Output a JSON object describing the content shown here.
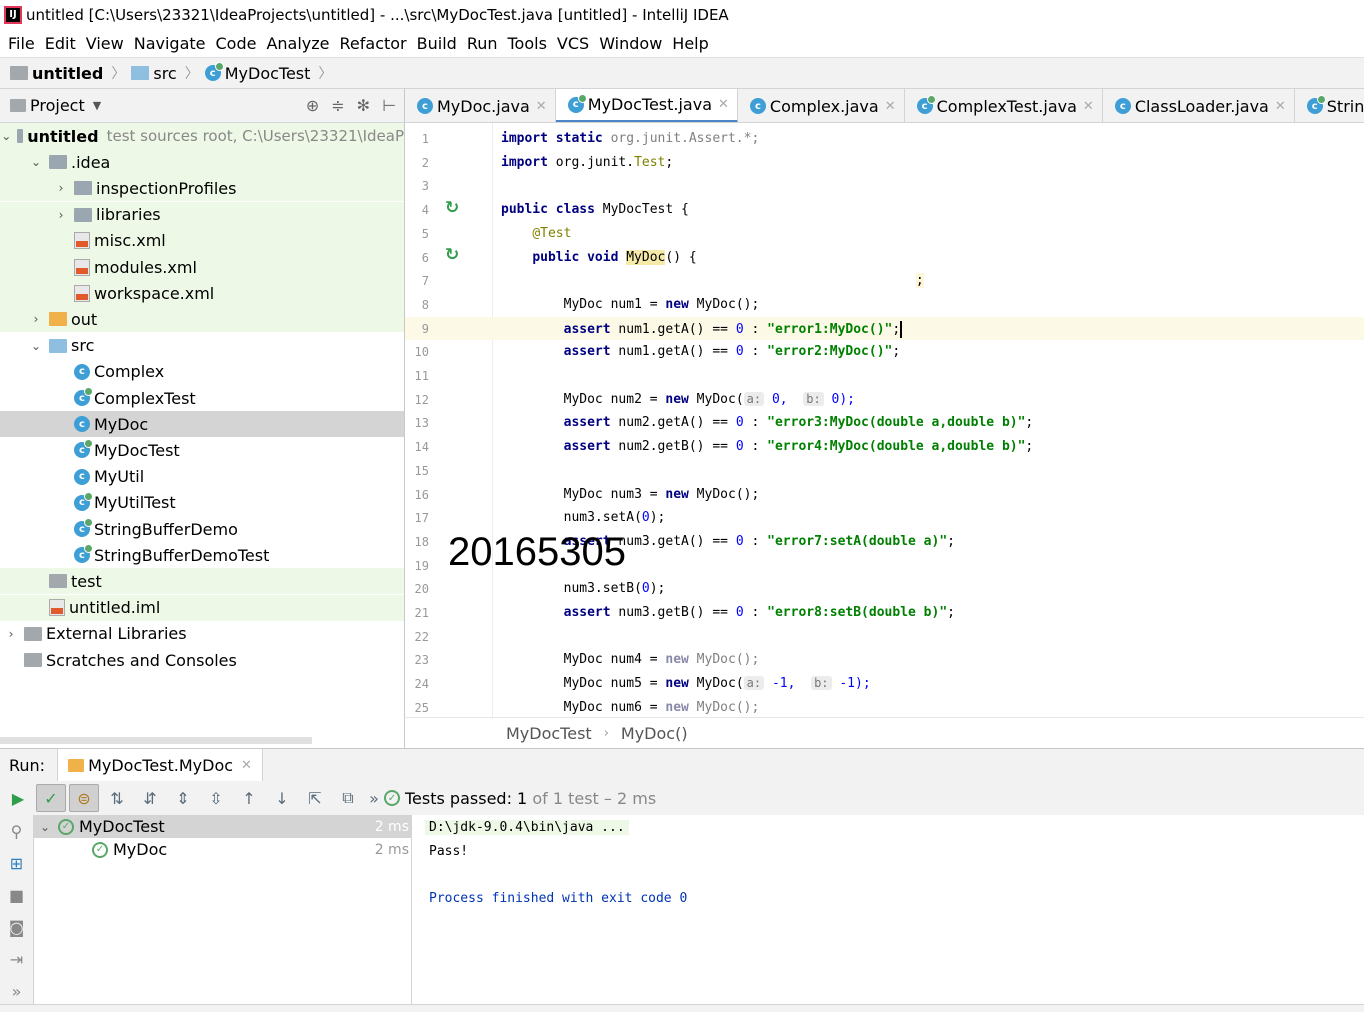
{
  "window": {
    "title": "untitled [C:\\Users\\23321\\IdeaProjects\\untitled] - ...\\src\\MyDocTest.java [untitled] - IntelliJ IDEA",
    "app_icon": "IJ"
  },
  "menu": [
    "File",
    "Edit",
    "View",
    "Navigate",
    "Code",
    "Analyze",
    "Refactor",
    "Build",
    "Run",
    "Tools",
    "VCS",
    "Window",
    "Help"
  ],
  "breadcrumb": [
    "untitled",
    "src",
    "MyDocTest"
  ],
  "project_panel": {
    "title": "Project",
    "tree": [
      {
        "label": "untitled",
        "hint": "test sources root,  C:\\Users\\23321\\IdeaP",
        "icon": "folder",
        "arrow": "⌄",
        "indent": 0,
        "green": true
      },
      {
        "label": ".idea",
        "icon": "folder",
        "arrow": "⌄",
        "indent": 1,
        "green": true
      },
      {
        "label": "inspectionProfiles",
        "icon": "folder",
        "arrow": "›",
        "indent": 2,
        "green": true
      },
      {
        "label": "libraries",
        "icon": "folder",
        "arrow": "›",
        "indent": 2,
        "green": true
      },
      {
        "label": "misc.xml",
        "icon": "xml",
        "arrow": "",
        "indent": 2,
        "green": true
      },
      {
        "label": "modules.xml",
        "icon": "xml",
        "arrow": "",
        "indent": 2,
        "green": true
      },
      {
        "label": "workspace.xml",
        "icon": "xml",
        "arrow": "",
        "indent": 2,
        "green": true
      },
      {
        "label": "out",
        "icon": "folder-orange",
        "arrow": "›",
        "indent": 1,
        "green": true
      },
      {
        "label": "src",
        "icon": "folder-blue",
        "arrow": "⌄",
        "indent": 1,
        "green": false
      },
      {
        "label": "Complex",
        "icon": "class",
        "arrow": "",
        "indent": 2,
        "green": false
      },
      {
        "label": "ComplexTest",
        "icon": "class-test",
        "arrow": "",
        "indent": 2,
        "green": false
      },
      {
        "label": "MyDoc",
        "icon": "class",
        "arrow": "",
        "indent": 2,
        "green": false,
        "selected": true
      },
      {
        "label": "MyDocTest",
        "icon": "class-test",
        "arrow": "",
        "indent": 2,
        "green": false
      },
      {
        "label": "MyUtil",
        "icon": "class",
        "arrow": "",
        "indent": 2,
        "green": false
      },
      {
        "label": "MyUtilTest",
        "icon": "class-test",
        "arrow": "",
        "indent": 2,
        "green": false
      },
      {
        "label": "StringBufferDemo",
        "icon": "class-test",
        "arrow": "",
        "indent": 2,
        "green": false
      },
      {
        "label": "StringBufferDemoTest",
        "icon": "class-test",
        "arrow": "",
        "indent": 2,
        "green": false
      },
      {
        "label": "test",
        "icon": "folder-grey",
        "arrow": "",
        "indent": 1,
        "green": true
      },
      {
        "label": "untitled.iml",
        "icon": "xml",
        "arrow": "",
        "indent": 1,
        "green": true
      },
      {
        "label": "External Libraries",
        "icon": "folder-grey",
        "arrow": "›",
        "indent": 0,
        "green": false
      },
      {
        "label": "Scratches and Consoles",
        "icon": "folder-grey",
        "arrow": "",
        "indent": 0,
        "green": false
      }
    ]
  },
  "editor_tabs": [
    {
      "label": "MyDoc.java",
      "active": false,
      "test": false
    },
    {
      "label": "MyDocTest.java",
      "active": true,
      "test": true
    },
    {
      "label": "Complex.java",
      "active": false,
      "test": false
    },
    {
      "label": "ComplexTest.java",
      "active": false,
      "test": true
    },
    {
      "label": "ClassLoader.java",
      "active": false,
      "test": false
    },
    {
      "label": "StringBuffer",
      "active": false,
      "test": true
    }
  ],
  "code_lines": [
    "1",
    "2",
    "3",
    "4",
    "5",
    "6",
    "7",
    "8",
    "9",
    "10",
    "11",
    "12",
    "13",
    "14",
    "15",
    "16",
    "17",
    "18",
    "19",
    "20",
    "21",
    "22",
    "23",
    "24",
    "25"
  ],
  "code": {
    "l1a": "import static",
    "l1b": " org.junit.Assert.*;",
    "l2a": "import",
    "l2b": " org.junit.",
    "l2c": "Test",
    ";": ";",
    "l4a": "public class",
    "l4b": " MyDocTest {",
    "l5": "@Test",
    "l6a": "public void",
    "l6b": "MyDoc",
    "l6c": "() {",
    "l7": ";",
    "new": "new",
    "assert": "assert",
    "l8a": "MyDoc num1 = ",
    "l8b": " MyDoc();",
    "l9a": " num1.getA() == ",
    "zero": "0",
    " : ": " : ",
    "l9s": "\"error1:MyDoc()\"",
    "l10s": "\"error2:MyDoc()\"",
    "l12a": "MyDoc num2 = ",
    "l12b": " MyDoc(",
    "ha": "a:",
    "hb": "b:",
    "l12c": "0,",
    "l12d": "0);",
    "l13a": " num2.getA() == ",
    "l13s": "\"error3:MyDoc(double a,double b)\"",
    "l14a": " num2.getB() == ",
    "l14s": "\"error4:MyDoc(double a,double b)\"",
    "l16a": "MyDoc num3 = ",
    "l16b": " MyDoc();",
    "l17a": "num3.setA(",
    "l17b": ");",
    "l18a": " num3.getA() == ",
    "l18s": "\"error7:setA(double a)\"",
    "l20a": "num3.setB(",
    "l20b": ");",
    "l21a": " num3.getB() == ",
    "l21s": "\"error8:setB(double b)\"",
    "l23a": "MyDoc num4 = ",
    "l23b": " MyDoc();",
    "l24a": "MyDoc num5 = ",
    "l24b": " MyDoc(",
    "m1": "-1,",
    "m2": "-1);",
    "l25a": "MyDoc num6 = ",
    "l25b": " MyDoc();"
  },
  "editor_breadcrumb": [
    "MyDocTest",
    "MyDoc()"
  ],
  "overlay_text": "20165305",
  "run_panel": {
    "label": "Run:",
    "tab": "MyDocTest.MyDoc",
    "status_prefix": "Tests passed: ",
    "passed": "1",
    "status_suffix": " of 1 test – 2 ms",
    "tests": [
      {
        "label": "MyDocTest",
        "time": "2 ms"
      },
      {
        "label": "MyDoc",
        "time": "2 ms"
      }
    ],
    "console": [
      "D:\\jdk-9.0.4\\bin\\java ...",
      "Pass!",
      "",
      "Process finished with exit code 0"
    ]
  },
  "colors": {
    "keyword": "#000080",
    "string": "#008000",
    "number": "#0000ff",
    "annotation": "#808000",
    "test_green": "#59a869",
    "tree_green": "#edf8e6"
  }
}
